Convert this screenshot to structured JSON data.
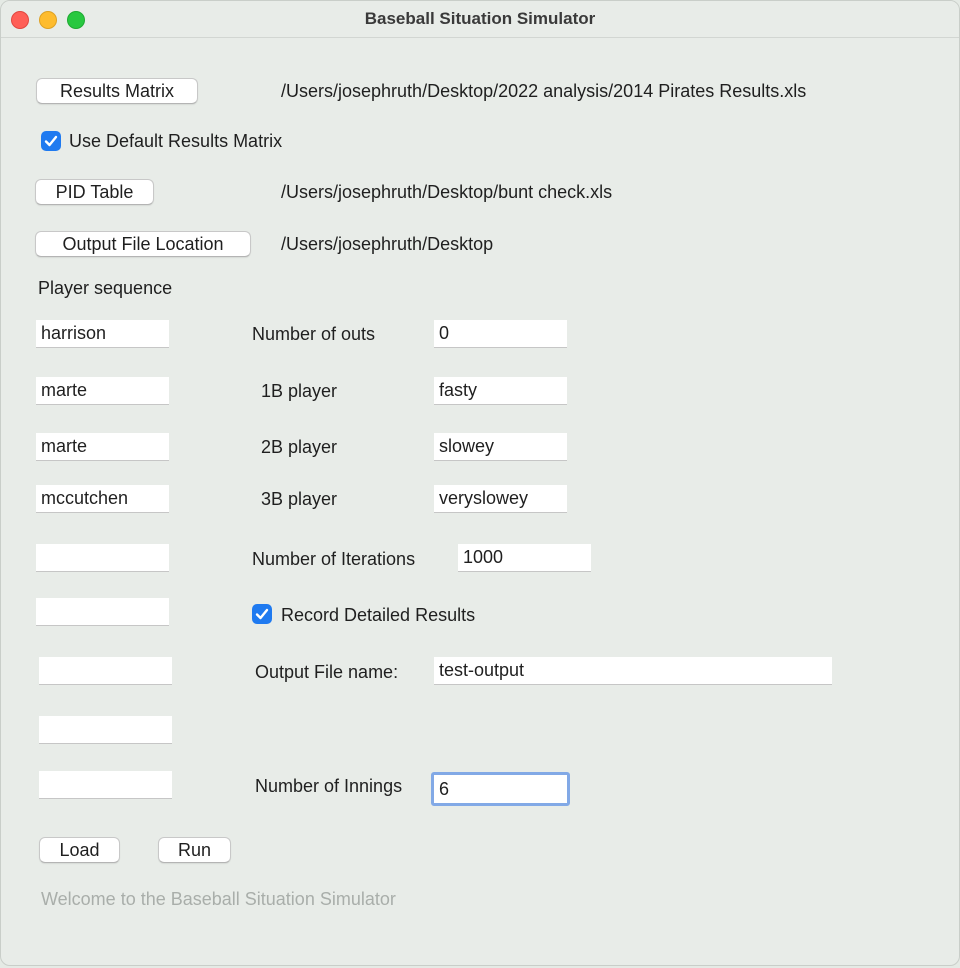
{
  "window": {
    "title": "Baseball Situation Simulator"
  },
  "files": {
    "results_matrix_label": "Results Matrix",
    "results_matrix_path": "/Users/josephruth/Desktop/2022 analysis/2014 Pirates Results.xls",
    "use_default_label": "Use Default Results Matrix",
    "use_default_checked": true,
    "pid_table_label": "PID Table",
    "pid_table_path": "/Users/josephruth/Desktop/bunt check.xls",
    "output_location_label": "Output File Location",
    "output_location_path": "/Users/josephruth/Desktop"
  },
  "sequence": {
    "label": "Player sequence",
    "players": [
      "harrison",
      "marte",
      "marte",
      "mccutchen",
      "",
      "",
      "",
      "",
      ""
    ]
  },
  "settings": {
    "outs_label": "Number of outs",
    "outs_value": "0",
    "first_label": "1B player",
    "first_value": "fasty",
    "second_label": "2B player",
    "second_value": "slowey",
    "third_label": "3B player",
    "third_value": "veryslowey",
    "iterations_label": "Number of Iterations",
    "iterations_value": "1000",
    "record_label": "Record Detailed Results",
    "record_checked": true,
    "output_name_label": "Output File name:",
    "output_name_value": "test-output",
    "innings_label": "Number of Innings",
    "innings_value": "6"
  },
  "actions": {
    "load_label": "Load",
    "run_label": "Run"
  },
  "status": {
    "message": "Welcome to the Baseball Situation Simulator"
  },
  "colors": {
    "checkbox": "#1f7af0",
    "focus_ring": "#82a9e6",
    "status_text": "#a9aeaa"
  }
}
